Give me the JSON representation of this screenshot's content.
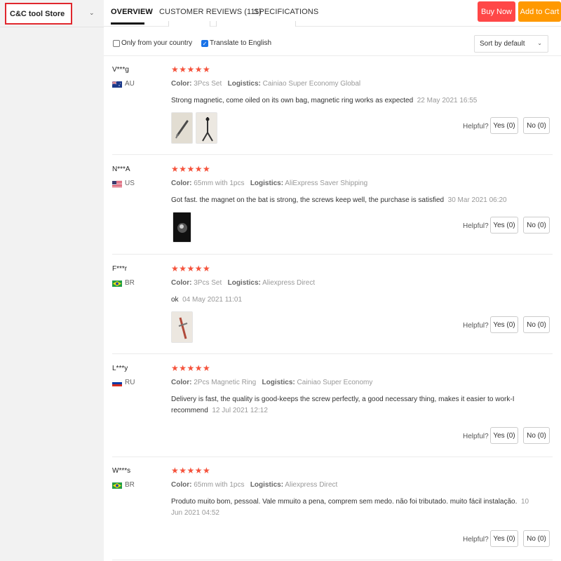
{
  "store": {
    "name": "C&C tool Store"
  },
  "tabs": [
    {
      "label": "OVERVIEW"
    },
    {
      "label": "CUSTOMER REVIEWS (111)"
    },
    {
      "label": "SPECIFICATIONS"
    }
  ],
  "actions": {
    "buy_now": "Buy Now",
    "add_to_cart": "Add to Cart"
  },
  "filters": {
    "only_country": {
      "label": "Only from your country",
      "checked": false
    },
    "translate": {
      "label": "Translate to English",
      "checked": true
    },
    "sort": "Sort by default"
  },
  "helpful_label": "Helpful?",
  "reviews": [
    {
      "user": "V***g",
      "country": "AU",
      "stars": "★★★★★",
      "color_label": "Color:",
      "color": "3Pcs Set",
      "logistics_label": "Logistics:",
      "logistics": "Cainiao Super Economy Global",
      "text": "Strong magnetic, come oiled on its own bag, magnetic ring works as expected",
      "date": "22 May 2021 16:55",
      "yes": "Yes (0)",
      "no": "No (0)"
    },
    {
      "user": "N***A",
      "country": "US",
      "stars": "★★★★★",
      "color_label": "Color:",
      "color": "65mm with 1pcs",
      "logistics_label": "Logistics:",
      "logistics": "AliExpress Saver Shipping",
      "text": "Got fast. the magnet on the bat is strong, the screws keep well, the purchase is satisfied",
      "date": "30 Mar 2021 06:20",
      "yes": "Yes (0)",
      "no": "No (0)"
    },
    {
      "user": "F***r",
      "country": "BR",
      "stars": "★★★★★",
      "color_label": "Color:",
      "color": "3Pcs Set",
      "logistics_label": "Logistics:",
      "logistics": "Aliexpress Direct",
      "text": "ok",
      "date": "04 May 2021 11:01",
      "yes": "Yes (0)",
      "no": "No (0)"
    },
    {
      "user": "L***y",
      "country": "RU",
      "stars": "★★★★★",
      "color_label": "Color:",
      "color": "2Pcs Magnetic Ring",
      "logistics_label": "Logistics:",
      "logistics": "Cainiao Super Economy",
      "text_line1": "Delivery is fast, the quality is good-keeps the screw perfectly, a good necessary thing, makes it easier to work-I",
      "text_line2": "recommend",
      "date": "12 Jul 2021 12:12",
      "yes": "Yes (0)",
      "no": "No (0)"
    },
    {
      "user": "W***s",
      "country": "BR",
      "stars": "★★★★★",
      "color_label": "Color:",
      "color": "65mm with 1pcs",
      "logistics_label": "Logistics:",
      "logistics": "Aliexpress Direct",
      "text_line1": "Produto muito bom, pessoal. Vale mmuito a pena, comprem sem medo. não foi tributado. muito fácil instalação.",
      "date_line1": "10",
      "date_line2": "Jun 2021 04:52",
      "yes": "Yes (0)",
      "no": "No (0)"
    }
  ]
}
